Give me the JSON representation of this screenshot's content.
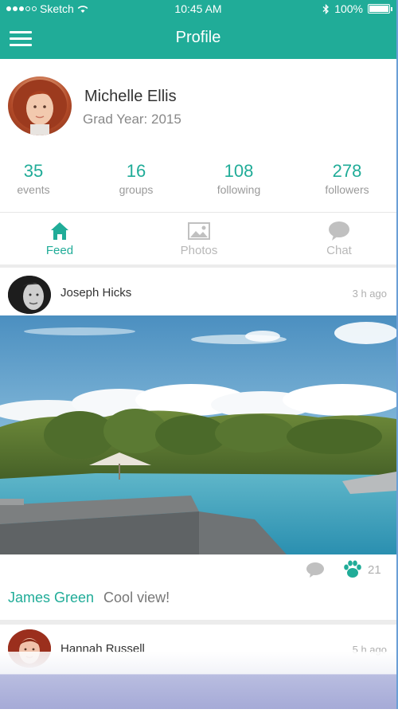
{
  "status_bar": {
    "carrier": "Sketch",
    "time": "10:45 AM",
    "battery": "100%"
  },
  "nav": {
    "title": "Profile"
  },
  "profile": {
    "name": "Michelle Ellis",
    "subtitle": "Grad Year: 2015"
  },
  "stats": [
    {
      "value": "35",
      "label": "events"
    },
    {
      "value": "16",
      "label": "groups"
    },
    {
      "value": "108",
      "label": "following"
    },
    {
      "value": "278",
      "label": "followers"
    }
  ],
  "tabs": [
    {
      "label": "Feed",
      "icon": "home-icon",
      "active": true
    },
    {
      "label": "Photos",
      "icon": "image-icon",
      "active": false
    },
    {
      "label": "Chat",
      "icon": "chat-bubble-icon",
      "active": false
    }
  ],
  "colors": {
    "accent": "#20ac98",
    "muted": "#b0b0b0"
  },
  "posts": [
    {
      "author": "Joseph Hicks",
      "time": "3 h ago",
      "likes": "21",
      "comment": {
        "author": "James Green",
        "text": "Cool view!"
      }
    },
    {
      "author": "Hannah Russell",
      "time": "5 h ago"
    }
  ]
}
